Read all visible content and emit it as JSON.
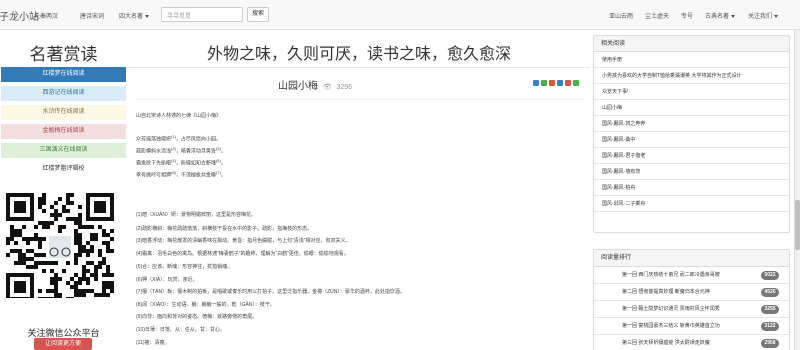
{
  "site": {
    "brand": "子龙小站"
  },
  "nav": {
    "left": [
      {
        "label": "先秦两汉",
        "caret": false
      },
      {
        "label": "唐诗宋词",
        "caret": false
      },
      {
        "label": "四大名著",
        "caret": true
      }
    ],
    "right": [
      {
        "label": "亚山云雨",
        "caret": false
      },
      {
        "label": "尘土虚天",
        "caret": false
      },
      {
        "label": "专号",
        "caret": false
      },
      {
        "label": "古典名著",
        "caret": true
      },
      {
        "label": "关注我们",
        "caret": true
      }
    ],
    "search_placeholder": "寻寻觅觅",
    "search_button": "搜索"
  },
  "left": {
    "title": "名著赏读",
    "menu": [
      {
        "label": "红楼梦在线阅读",
        "bg": "#337ab7",
        "fg": "#ffffff"
      },
      {
        "label": "西游记在线阅读",
        "bg": "#d9edf7",
        "fg": "#31708f"
      },
      {
        "label": "水浒传在线阅读",
        "bg": "#fcf8e3",
        "fg": "#8a6d3b"
      },
      {
        "label": "金瓶梅在线阅读",
        "bg": "#f2dede",
        "fg": "#a94442"
      },
      {
        "label": "三国演义在线阅读",
        "bg": "#dff0d8",
        "fg": "#3c763d"
      },
      {
        "label": "红楼梦脂评辑校",
        "bg": "#ffffff",
        "fg": "#333333"
      }
    ],
    "wechat_title": "关注微信公众平台",
    "wechat_btn": "让阅读更方便"
  },
  "main": {
    "headline": "外物之味，久则可厌，读书之味，愈久愈深",
    "article_title": "山园小梅",
    "views": "3296",
    "lines": [
      {
        "text": "山自北宋诗人林逋的七律《山园小梅》",
        "sup": ""
      },
      {
        "text": "众芳摇落独暄妍",
        "sup": "(1)",
        "rest": "，占尽风情向小园。"
      },
      {
        "text": "疏影横斜水清浅",
        "sup": "(2)",
        "rest": "，暗香浮动月黄昏",
        "sup2": "(3)",
        "rest2": "。"
      },
      {
        "text": "霜禽欲下先偷眼",
        "sup": "(4)",
        "rest": "，粉蝶如知合断魂",
        "sup2": "(5)",
        "rest2": "。"
      },
      {
        "text": "幸有微吟可相狎",
        "sup": "(6)",
        "rest": "，不须檀板共金樽",
        "sup2": "(7)",
        "rest2": "。"
      },
      {
        "text": "(1)暄（XUĀN）妍：景物明媚鲜丽，这里是形容梅花。",
        "sup": ""
      },
      {
        "text": "(2)疏影横斜：梅花疏疏落落，斜横枝干投在水中的影子。疏影，指梅枝的形态。",
        "sup": ""
      },
      {
        "text": "(3)暗香浮动：梅花散发的清幽香味在飘动。黄昏：指月色朦胧，与上句“清浅”相对应，有双关义。",
        "sup": ""
      },
      {
        "text": "(4)霜禽：羽毛白色的禽鸟。根据林逋“梅妻鹤子”的趣称，理解为“白鹤”更佳。偷眼：偷偷地观看。",
        "sup": ""
      },
      {
        "text": "(5)合：应该。断魂：形容神往，犹指销魂。",
        "sup": ""
      },
      {
        "text": "(6)狎（XIÁ）：玩赏，亲近。",
        "sup": ""
      },
      {
        "text": "(7)檀（TÁN）板：檀木制的拍板，是唱歌或奏乐时用以打拍子。这里泛指乐器。金樽（ZŪN）：豪华的酒杯，此处指饮酒。",
        "sup": ""
      },
      {
        "text": "(8)阔（XIÁO）：生动语。躺：躺躺一般的。乾（GĀN）：枝干。",
        "sup": ""
      },
      {
        "text": "(9)向背：面向和背对的姿态。猗梅：就路旁傍的角尾。",
        "sup": ""
      },
      {
        "text": "(10)日薄：日落。从：任从。甘：甘心。",
        "sup": ""
      },
      {
        "text": "(11)瘦：清瘦。",
        "sup": ""
      }
    ]
  },
  "right": {
    "related_title": "相关阅读",
    "related": [
      "使用手册",
      "小男孩为喜欢的大学自制T恤给乘漏潮英 大学将其作为正式设计",
      "众览天下事!",
      "山园小梅",
      "国风·鄘风·鹑之奔奔",
      "国风·鄘风·桑中",
      "国风·鄘风·君子偕老",
      "国风·鄘风·墙有茨",
      "国风·鄘风·柏舟",
      "国风·邶风·二子乘舟"
    ],
    "ranking_title": "阅读量排行",
    "ranking": [
      {
        "label": "第一回  西门庆热结十弟兄  武二郎冷遇亲哥嫂",
        "count": "5022"
      },
      {
        "label": "第二回  悟彻菩提真妙理  断魔归本合元神",
        "count": "4526"
      },
      {
        "label": "第一回  甄士隐梦幻识通灵  贾雨村风尘怀闺秀",
        "count": "3255"
      },
      {
        "label": "第一回  宴桃园豪杰三结义  斩黄巾英雄首立功",
        "count": "3122"
      },
      {
        "label": "第三回  张天师祈禳瘟疫  洪太尉误走妖魔",
        "count": "2958"
      }
    ]
  },
  "colors": {
    "primary": "#337ab7",
    "info": "#d9edf7",
    "warning": "#fcf8e3",
    "danger": "#f2dede",
    "success": "#dff0d8",
    "badge": "#777777",
    "wechat": "#d9534f"
  }
}
